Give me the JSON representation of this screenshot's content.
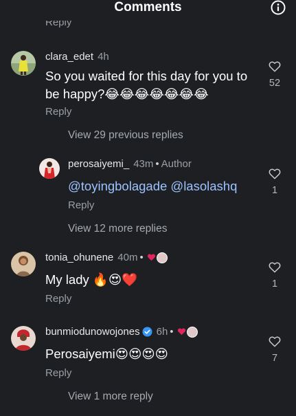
{
  "header": {
    "title": "Comments"
  },
  "top_reply_label": "Reply",
  "comments": [
    {
      "username": "clara_edet",
      "time": "4h",
      "text": "So you waited for this day for you to be happy?😂😂😂😂😂😂😂",
      "reply_label": "Reply",
      "likes": "52",
      "view_replies": "View 29 previous replies"
    },
    {
      "username": "perosaiyemi_",
      "time": "43m",
      "author_badge": "Author",
      "mentions": [
        "@toyingbolagade",
        "@lasolashq"
      ],
      "reply_label": "Reply",
      "likes": "1",
      "view_replies": "View 12 more replies"
    },
    {
      "username": "tonia_ohunene",
      "time": "40m",
      "text": "My lady 🔥😍❤️",
      "reply_label": "Reply",
      "likes": "1"
    },
    {
      "username": "bunmiodunowojones",
      "time": "6h",
      "text": "Perosaiyemi😍😍😍😍",
      "reply_label": "Reply",
      "likes": "7",
      "view_replies": "View 1 more reply"
    }
  ],
  "colors": {
    "background": "#1d1f23",
    "mention": "#9cc3ff",
    "liked_heart": "#e0245e",
    "verified": "#3897f0"
  },
  "icons": [
    "info-icon",
    "heart-outline-icon",
    "heart-filled-icon",
    "verified-badge-icon"
  ]
}
